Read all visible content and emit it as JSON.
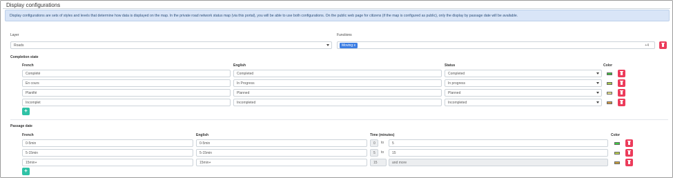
{
  "page": {
    "title": "Display configurations",
    "info": "Display configurations are sets of styles and levels that determine how data is displayed on the map. In the private road network status map (via this portal), you will be able to use both configurations. On the public web page for citizens (if the map is configured as public), only the display by passage date will be available."
  },
  "layer": {
    "label": "Layer",
    "value": "Roads"
  },
  "functions": {
    "label": "Functions",
    "tag": "Moving",
    "tag_remove": "x",
    "more": "+4"
  },
  "completion": {
    "title": "Completion state",
    "headers": {
      "french": "French",
      "english": "English",
      "status": "Status",
      "color": "Color"
    },
    "rows": [
      {
        "french": "Complété",
        "english": "Completed",
        "status": "Completed",
        "color": "#3fbf3f"
      },
      {
        "french": "En cours",
        "english": "In Progress",
        "status": "In progress",
        "color": "#a9cf4a"
      },
      {
        "french": "Planifié",
        "english": "Planned",
        "status": "Planned",
        "color": "#e9e58a"
      },
      {
        "french": "Incomplet",
        "english": "Incompleted",
        "status": "Incompleted",
        "color": "#d39a43"
      }
    ],
    "add_label": "+"
  },
  "passage": {
    "title": "Passage date",
    "headers": {
      "french": "French",
      "english": "English",
      "time": "Time (minutes)",
      "color": "Color"
    },
    "rows": [
      {
        "french": "0-5min",
        "english": "0-5min",
        "from": "0",
        "to_word": "to",
        "to": "5",
        "color": "#3fcf3f"
      },
      {
        "french": "5-15min",
        "english": "5-15min",
        "from": "5",
        "to_word": "to",
        "to": "15",
        "color": "#b9d04a"
      },
      {
        "french": "15min+",
        "english": "15min+",
        "from": "15",
        "to_word": "",
        "to": "and more",
        "color": "#c9a03a"
      }
    ],
    "add_label": "+"
  }
}
